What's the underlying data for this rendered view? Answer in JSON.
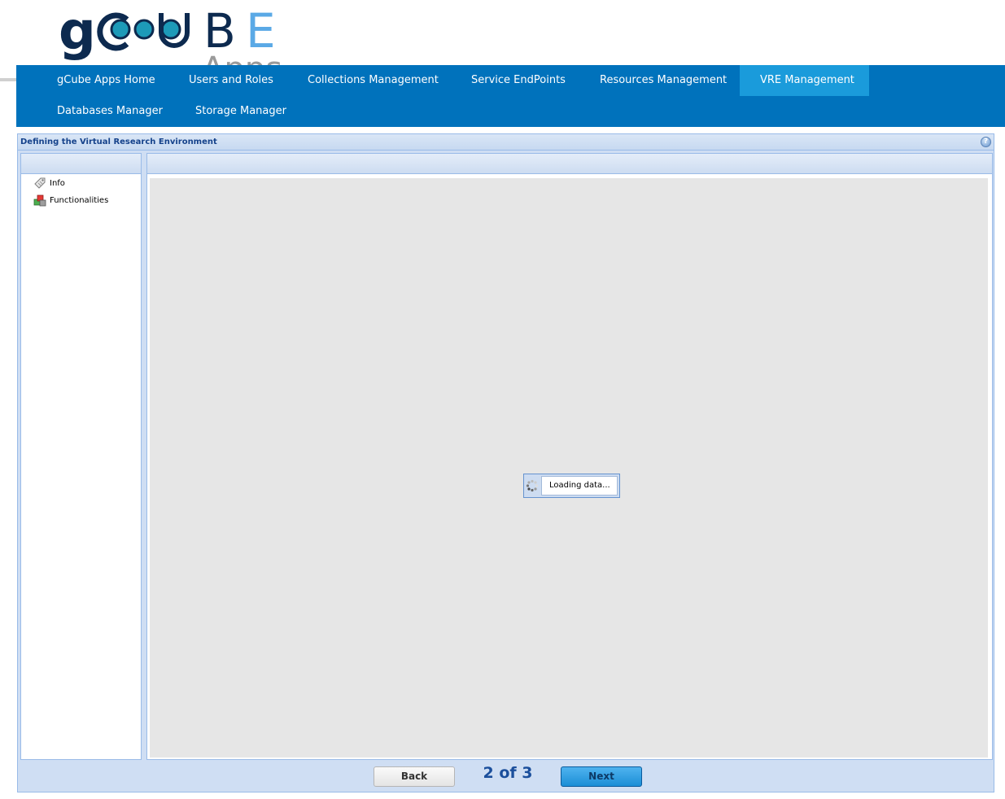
{
  "brand": {
    "logo_text": "gCUBE",
    "logo_subtext": "Apps",
    "colors": {
      "navy": "#0d2a4f",
      "sky": "#5aa9e6",
      "teal": "#2a9bb8"
    }
  },
  "nav": {
    "items": [
      {
        "label": "gCube Apps Home",
        "active": false
      },
      {
        "label": "Users and Roles",
        "active": false
      },
      {
        "label": "Collections Management",
        "active": false
      },
      {
        "label": "Service EndPoints",
        "active": false
      },
      {
        "label": "Resources Management",
        "active": false
      },
      {
        "label": "VRE Management",
        "active": true
      },
      {
        "label": "Databases Manager",
        "active": false
      },
      {
        "label": "Storage Manager",
        "active": false
      }
    ],
    "colors": {
      "bar": "#0072bc",
      "active": "#1a9bdb"
    }
  },
  "panel": {
    "title": "Defining the Virtual Research Environment",
    "help_icon": "help-icon"
  },
  "tree": {
    "items": [
      {
        "label": "Info",
        "icon": "tag-icon"
      },
      {
        "label": "Functionalities",
        "icon": "cubes-icon"
      }
    ]
  },
  "content": {
    "loading_text": "Loading data..."
  },
  "footer": {
    "back_label": "Back",
    "next_label": "Next",
    "step_text": "2 of 3",
    "current_step": 2,
    "total_steps": 3
  }
}
